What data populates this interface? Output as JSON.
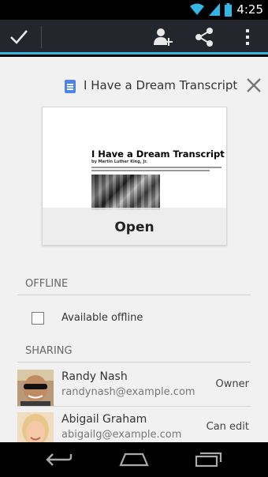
{
  "status_bar": {
    "time": "4:25"
  },
  "action_bar": {
    "icons": [
      "check-icon",
      "add-person-icon",
      "share-icon",
      "overflow-menu-icon"
    ]
  },
  "document": {
    "title": "I Have a Dream Transcript",
    "preview_title": "I Have a Dream Transcript",
    "preview_author": "by Martin Luther King, Jr.",
    "open_label": "Open"
  },
  "offline": {
    "section_label": "OFFLINE",
    "checkbox_label": "Available offline",
    "checked": false
  },
  "sharing": {
    "section_label": "SHARING",
    "people": [
      {
        "name": "Randy Nash",
        "email": "randynash@example.com",
        "role": "Owner"
      },
      {
        "name": "Abigail Graham",
        "email": "abigailg@example.com",
        "role": "Can edit"
      }
    ]
  },
  "colors": {
    "accent": "#33b5e5",
    "action_bar": "#23262c",
    "background": "#f1f1f1"
  }
}
